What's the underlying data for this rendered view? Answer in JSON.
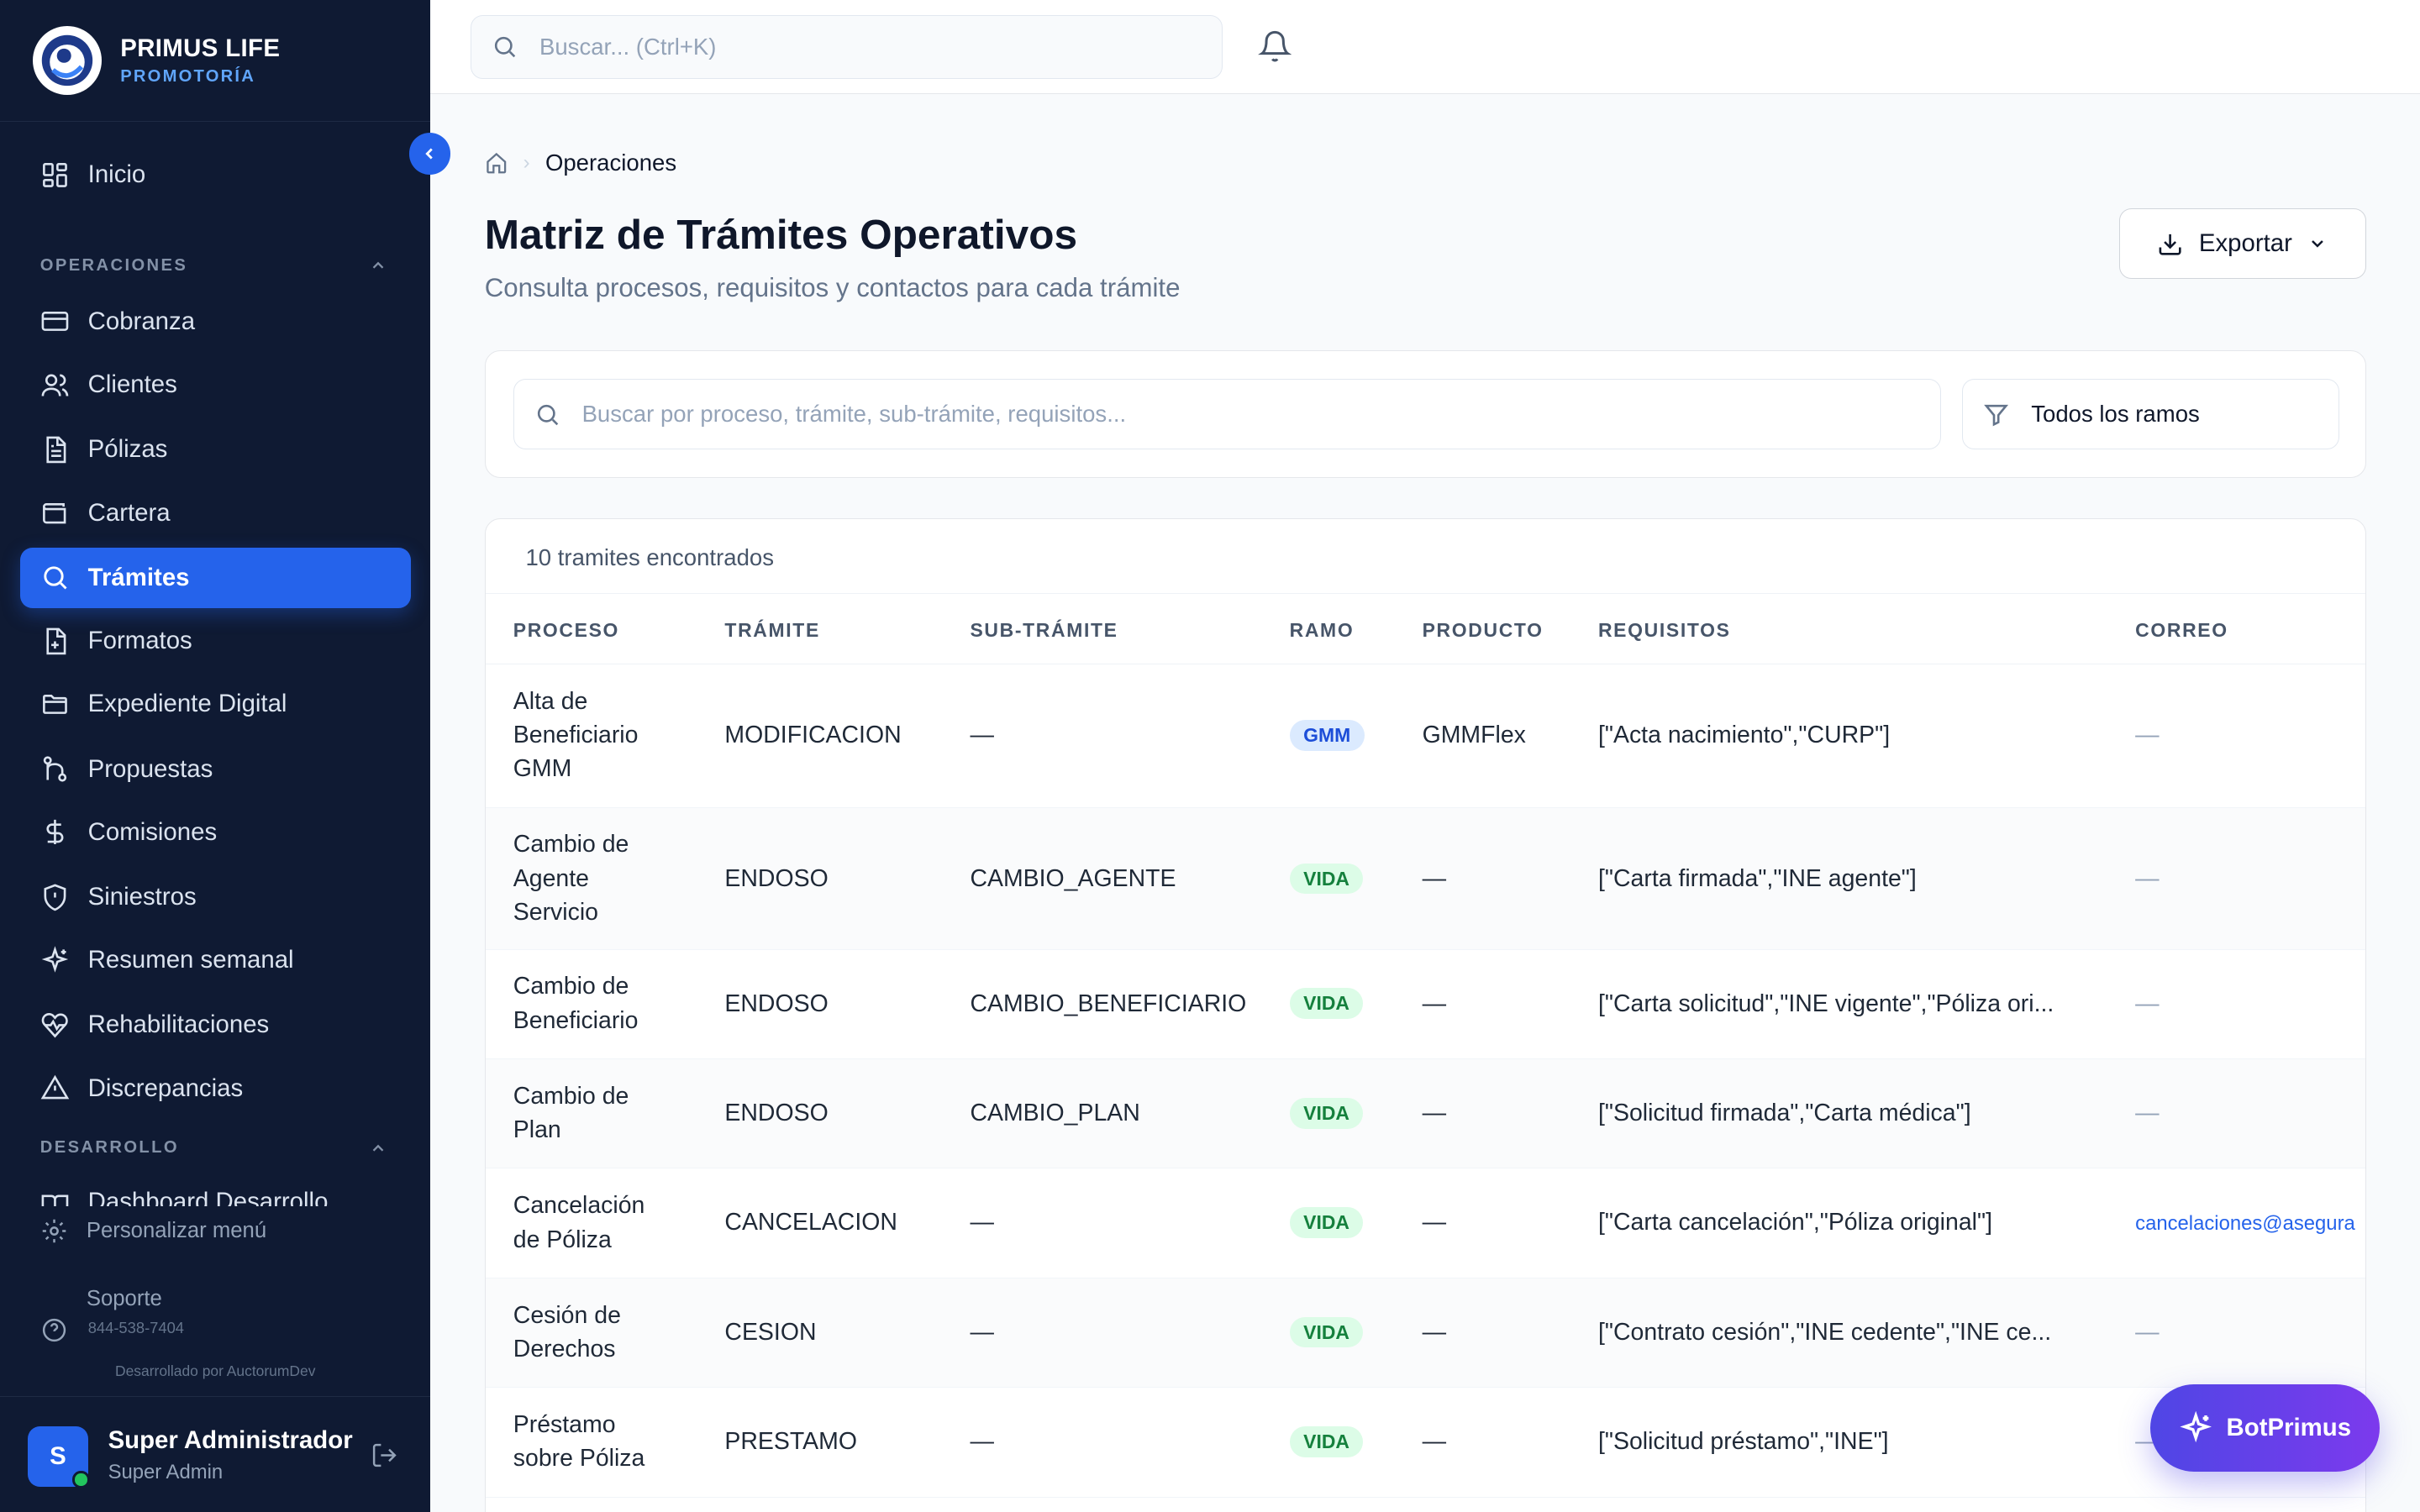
{
  "brand": {
    "name": "PRIMUS LIFE",
    "subtitle": "PROMOTORÍA"
  },
  "sidebar": {
    "home": "Inicio",
    "section_operaciones": "OPERACIONES",
    "items": [
      {
        "label": "Cobranza",
        "icon": "credit-card-icon"
      },
      {
        "label": "Clientes",
        "icon": "users-icon"
      },
      {
        "label": "Pólizas",
        "icon": "document-icon"
      },
      {
        "label": "Cartera",
        "icon": "wallet-icon"
      },
      {
        "label": "Trámites",
        "icon": "search-icon",
        "active": true
      },
      {
        "label": "Formatos",
        "icon": "file-plus-icon"
      },
      {
        "label": "Expediente Digital",
        "icon": "folder-icon"
      },
      {
        "label": "Propuestas",
        "icon": "git-branch-icon"
      },
      {
        "label": "Comisiones",
        "icon": "dollar-icon"
      },
      {
        "label": "Siniestros",
        "icon": "shield-icon"
      },
      {
        "label": "Resumen semanal",
        "icon": "sparkle-icon"
      },
      {
        "label": "Rehabilitaciones",
        "icon": "heart-pulse-icon"
      },
      {
        "label": "Discrepancias",
        "icon": "warning-icon"
      }
    ],
    "section_desarrollo": "DESARROLLO",
    "dashboard_desarrollo": "Dashboard Desarrollo",
    "personalizar": "Personalizar menú",
    "soporte": "Soporte",
    "soporte_phone": "844-538-7404",
    "developed_by": "Desarrollado por AuctorumDev"
  },
  "user": {
    "initial": "S",
    "name": "Super Administrador",
    "role": "Super Admin"
  },
  "topbar": {
    "search_placeholder": "Buscar... (Ctrl+K)"
  },
  "breadcrumb": {
    "current": "Operaciones"
  },
  "page": {
    "title": "Matriz de Trámites Operativos",
    "subtitle": "Consulta procesos, requisitos y contactos para cada trámite",
    "export_label": "Exportar"
  },
  "filters": {
    "search_placeholder": "Buscar por proceso, trámite, sub-trámite, requisitos...",
    "ramo_selected": "Todos los ramos"
  },
  "table": {
    "count_label": "10 tramites encontrados",
    "headers": [
      "PROCESO",
      "TRÁMITE",
      "SUB-TRÁMITE",
      "RAMO",
      "PRODUCTO",
      "REQUISITOS",
      "CORREO"
    ],
    "rows": [
      {
        "proceso": [
          "Alta de",
          "Beneficiario",
          "GMM"
        ],
        "tramite": "MODIFICACION",
        "subtramite": "—",
        "ramo": "GMM",
        "producto": "GMMFlex",
        "requisitos": "[\"Acta nacimiento\",\"CURP\"]",
        "correo": "—"
      },
      {
        "proceso": [
          "Cambio de",
          "Agente",
          "Servicio"
        ],
        "tramite": "ENDOSO",
        "subtramite": "CAMBIO_AGENTE",
        "ramo": "VIDA",
        "producto": "—",
        "requisitos": "[\"Carta firmada\",\"INE agente\"]",
        "correo": "—"
      },
      {
        "proceso": [
          "Cambio de",
          "Beneficiario"
        ],
        "tramite": "ENDOSO",
        "subtramite": "CAMBIO_BENEFICIARIO",
        "ramo": "VIDA",
        "producto": "—",
        "requisitos": "[\"Carta solicitud\",\"INE vigente\",\"Póliza ori...",
        "correo": "—"
      },
      {
        "proceso": [
          "Cambio de",
          "Plan"
        ],
        "tramite": "ENDOSO",
        "subtramite": "CAMBIO_PLAN",
        "ramo": "VIDA",
        "producto": "—",
        "requisitos": "[\"Solicitud firmada\",\"Carta médica\"]",
        "correo": "—"
      },
      {
        "proceso": [
          "Cancelación",
          "de Póliza"
        ],
        "tramite": "CANCELACION",
        "subtramite": "—",
        "ramo": "VIDA",
        "producto": "—",
        "requisitos": "[\"Carta cancelación\",\"Póliza original\"]",
        "correo": "cancelaciones@asegura"
      },
      {
        "proceso": [
          "Cesión de",
          "Derechos"
        ],
        "tramite": "CESION",
        "subtramite": "—",
        "ramo": "VIDA",
        "producto": "—",
        "requisitos": "[\"Contrato cesión\",\"INE cedente\",\"INE ce...",
        "correo": "—"
      },
      {
        "proceso": [
          "Préstamo",
          "sobre Póliza"
        ],
        "tramite": "PRESTAMO",
        "subtramite": "—",
        "ramo": "VIDA",
        "producto": "—",
        "requisitos": "[\"Solicitud préstamo\",\"INE\"]",
        "correo": "—"
      }
    ]
  },
  "bot": {
    "label": "BotPrimus"
  },
  "colors": {
    "sidebar_bg": "#0f1a33",
    "accent": "#2563eb",
    "bot_gradient_start": "#4f46e5",
    "bot_gradient_end": "#7c3aed"
  }
}
